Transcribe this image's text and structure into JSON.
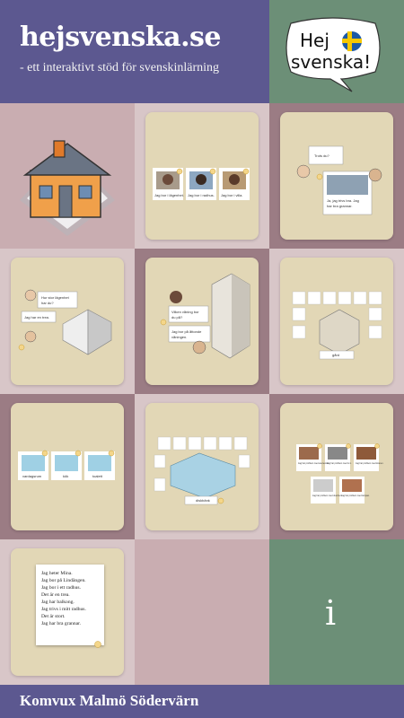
{
  "header": {
    "title": "hejsvenska.se",
    "tagline": "- ett interaktivt stöd för svenskinlärning",
    "logo_line1": "Hej",
    "logo_line2": "svenska!"
  },
  "tiles": {
    "t2": {
      "labels": [
        "Jag bor i lägenhet.",
        "Jag bor i radhus.",
        "Jag bor i villa."
      ]
    },
    "t3": {
      "question": "Trots du?",
      "answer_line1": "Ja, jag trivs bra. Jag",
      "answer_line2": "har bra grannar."
    },
    "t4": {
      "question_line1": "Hur stor lägenhet",
      "question_line2": "har du?",
      "answer": "Jag har en trea."
    },
    "t5": {
      "question_line1": "Vilken våning bor",
      "question_line2": "du på?",
      "answer_line1": "Jag bor på åttonde",
      "answer_line2": "våningen."
    },
    "t6": {
      "label": "gård"
    },
    "t7": {
      "labels": [
        "vardagsrum",
        "kök",
        "toalett"
      ]
    },
    "t8": {
      "label": "diskbänk"
    },
    "t9": {
      "labels": [
        "Jag har problem med elementet.",
        "Jag har problem med tv:n.",
        "Jag har problem med kranen.",
        "Jag har problem med duschen.",
        "Jag har problem med lampan."
      ]
    },
    "t10": {
      "lines": [
        "Jag heter Mina.",
        "Jag bor på Lindängen.",
        "Jag bor i ett radhus.",
        "Det är en trea.",
        "Jag har balkong.",
        "Jag trivs i mitt radhus.",
        "Det är stort.",
        "Jag har bra grannar."
      ]
    },
    "t12": {
      "info": "i"
    }
  },
  "footer": {
    "text": "Komvux Malmö Södervärn"
  },
  "colors": {
    "header_purple": "#5c5890",
    "green": "#6c8f77",
    "card_beige": "#e2d7b6"
  }
}
